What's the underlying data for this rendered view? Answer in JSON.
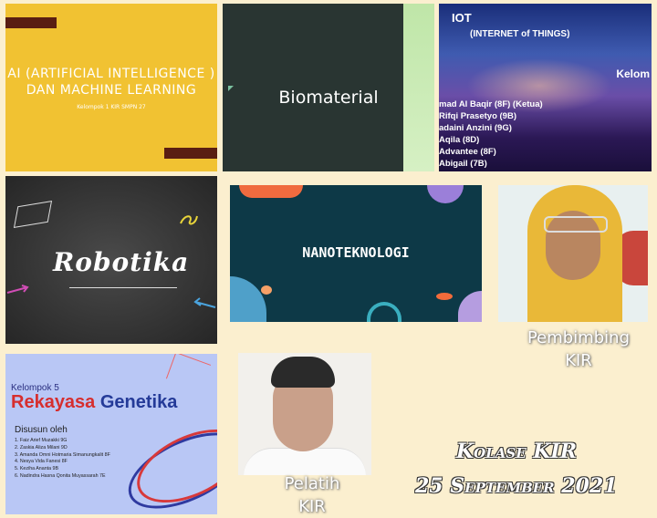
{
  "tiles": {
    "ai": {
      "title_line1": "AI (ARTIFICIAL INTELLIGENCE )",
      "title_line2": "DAN MACHINE LEARNING",
      "subtitle": "Kelompok 1 KIR SMPN 27"
    },
    "biomaterial": {
      "title": "Biomaterial"
    },
    "iot": {
      "title": "IOT",
      "subtitle": "(INTERNET of THINGS)",
      "side_text": "Kelom",
      "members": [
        "mad Al Baqir (8F) (Ketua)",
        "Rifqi Prasetyo (9B)",
        "adaini Anzini (9G)",
        "Aqila (8D)",
        "Advantee (8F)",
        "Abigail (7B)"
      ]
    },
    "robotika": {
      "title": "Robotika"
    },
    "nano": {
      "title": "NANOTEKNOLOGI"
    },
    "pembimbing": {
      "caption_line1": "Pembimbing",
      "caption_line2": "KIR"
    },
    "rekayasa": {
      "group": "Kelompok 5",
      "title_red": "Rekayasa ",
      "title_blue": "Genetika",
      "authored_by": "Disusun oleh",
      "members": [
        "1. Faiz Arief Muzakki 9G",
        "2. Zaskia Aliza Milani 9D",
        "3. Amanda Omni Hotmaria Simanungkalit 8F",
        "4. Nesya Vida Fanesi 8F",
        "5. Keziha Ananta 9B",
        "6. Nadindra Hasna Qonita Muyassarah 7E"
      ]
    },
    "pelatih": {
      "caption_line1": "Pelatih",
      "caption_line2": "KIR"
    }
  },
  "collage": {
    "title": "Kolase KIR",
    "date": "25 September 2021"
  }
}
